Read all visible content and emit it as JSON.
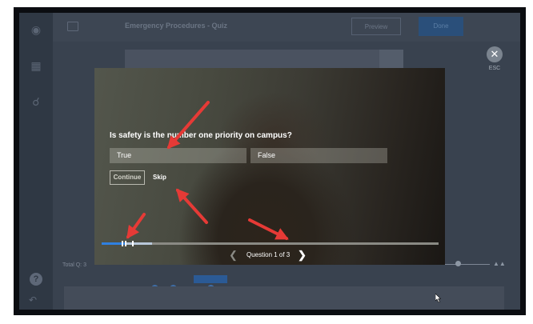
{
  "editor": {
    "title": "Emergency Procedures - Quiz",
    "preview_label": "Preview",
    "done_label": "Done",
    "total_label": "Total Q: 3"
  },
  "player": {
    "esc_label": "ESC",
    "question": "Is safety is the number one priority on campus?",
    "answers": [
      "True",
      "False"
    ],
    "continue_label": "Continue",
    "skip_label": "Skip",
    "pager_label": "Question 1 of 3",
    "progress_fraction": 0.07
  },
  "colors": {
    "annotation_arrow": "#e63a36",
    "progress_fill": "#2f80e0",
    "done_button": "#2a4f7a"
  },
  "icons": [
    "cube-icon",
    "book-icon",
    "search-icon",
    "help-icon",
    "undo-icon",
    "close-icon",
    "chevron-left-icon",
    "chevron-right-icon",
    "mouse-cursor-icon"
  ]
}
